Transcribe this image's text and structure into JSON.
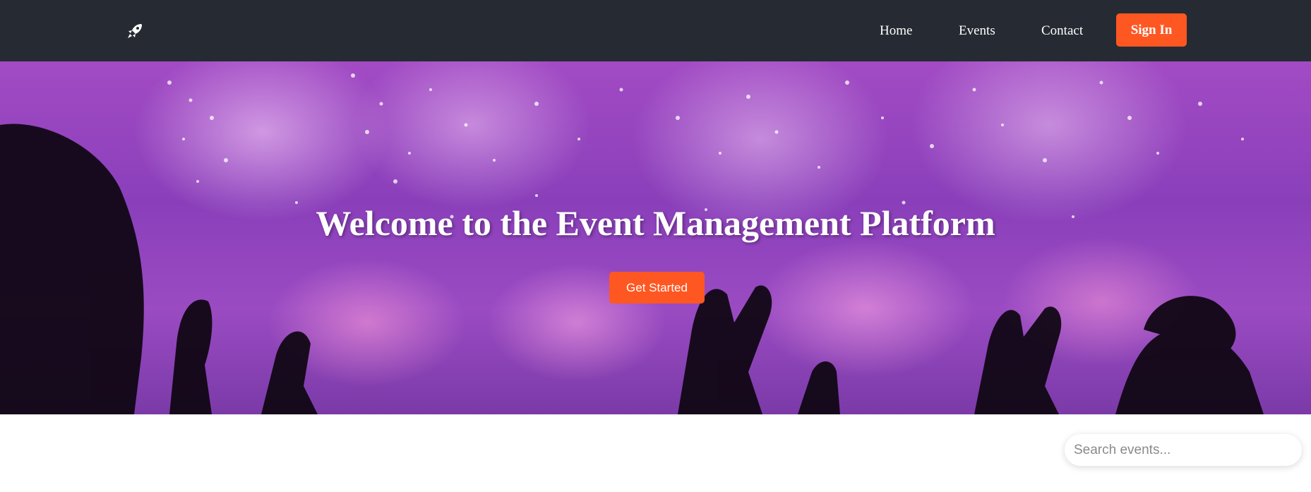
{
  "nav": {
    "logo_icon": "rocket-icon",
    "links": [
      {
        "label": "Home"
      },
      {
        "label": "Events"
      },
      {
        "label": "Contact"
      }
    ],
    "signin_label": "Sign In"
  },
  "hero": {
    "title": "Welcome to the Event Management Platform",
    "cta_label": "Get Started",
    "background_image": "concert-fireworks-crowd-photo"
  },
  "search": {
    "placeholder": "Search events...",
    "value": ""
  },
  "colors": {
    "navbar_bg": "#262b33",
    "accent": "#ff5722",
    "hero_tint": "#8a3fba"
  }
}
